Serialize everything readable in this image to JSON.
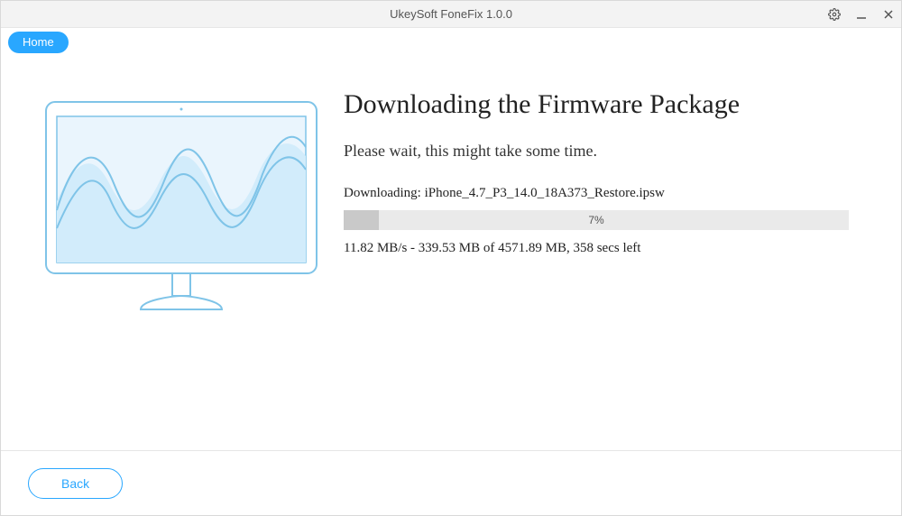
{
  "titlebar": {
    "title": "UkeySoft FoneFix 1.0.0"
  },
  "toolbar": {
    "home_label": "Home"
  },
  "main": {
    "heading": "Downloading the Firmware Package",
    "subtext": "Please wait, this might take some time.",
    "download_label_prefix": "Downloading: ",
    "download_filename": "iPhone_4.7_P3_14.0_18A373_Restore.ipsw",
    "progress_percent": "7%",
    "progress_value": 7,
    "stats": "11.82 MB/s - 339.53 MB of 4571.89 MB, 358 secs left"
  },
  "footer": {
    "back_label": "Back"
  },
  "icons": {
    "settings": "gear-icon",
    "minimize": "minimize-icon",
    "close": "close-icon"
  },
  "colors": {
    "accent": "#29a7ff",
    "illus_stroke": "#7fc4e8",
    "illus_fill": "#d2ecfb"
  }
}
